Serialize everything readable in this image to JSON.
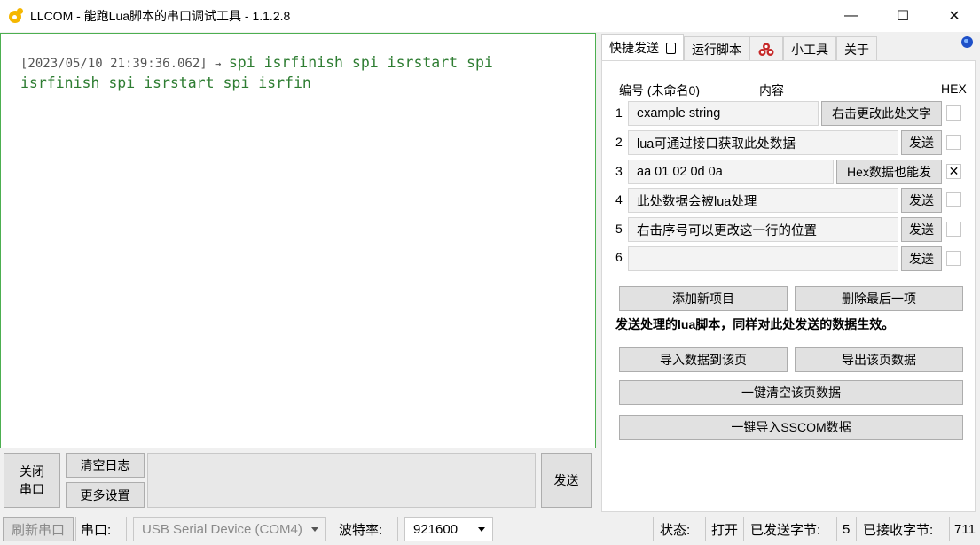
{
  "window": {
    "title": "LLCOM - 能跑Lua脚本的串口调试工具 - 1.1.2.8",
    "minimize": "—",
    "maximize": "☐",
    "close": "✕"
  },
  "log": {
    "timestamp": "[2023/05/10 21:39:36.062]",
    "arrow": "→",
    "line1": "spi isrfinish spi isrstart spi",
    "line2": "isrfinish spi isrstart spi isrfin"
  },
  "send_area": {
    "close_port": [
      "关闭",
      "串口"
    ],
    "clear_log": "清空日志",
    "more_settings": "更多设置",
    "send": "发送",
    "input_value": ""
  },
  "tabs": [
    {
      "label": "快捷发送"
    },
    {
      "label": "运行脚本"
    },
    {
      "label": ""
    },
    {
      "label": "小工具"
    },
    {
      "label": "关于"
    }
  ],
  "quick_send": {
    "header_id": "编号 (未命名0)",
    "header_content": "内容",
    "header_hex": "HEX",
    "rows": [
      {
        "num": "1",
        "text": "example string",
        "button": "右击更改此处文字",
        "hex": false
      },
      {
        "num": "2",
        "text": "lua可通过接口获取此处数据",
        "button": "发送",
        "hex": false
      },
      {
        "num": "3",
        "text": "aa 01 02 0d 0a",
        "button": "Hex数据也能发",
        "hex": true
      },
      {
        "num": "4",
        "text": "此处数据会被lua处理",
        "button": "发送",
        "hex": false
      },
      {
        "num": "5",
        "text": "右击序号可以更改这一行的位置",
        "button": "发送",
        "hex": false
      },
      {
        "num": "6",
        "text": "",
        "button": "发送",
        "hex": false
      }
    ],
    "add_item": "添加新项目",
    "delete_last": "删除最后一项",
    "note": "发送处理的lua脚本，同样对此处发送的数据生效。",
    "import_data": "导入数据到该页",
    "export_data": "导出该页数据",
    "clear_page": "一键清空该页数据",
    "import_sscom": "一键导入SSCOM数据",
    "check_mark": "✕"
  },
  "status": {
    "refresh_port": "刷新串口",
    "port_label": "串口:",
    "port_value": "USB Serial Device (COM4)",
    "baud_label": "波特率:",
    "baud_value": "921600",
    "state_label": "状态:",
    "state_value": "打开",
    "sent_label": "已发送字节:",
    "sent_value": "5",
    "recv_label": "已接收字节:",
    "recv_value": "711"
  }
}
